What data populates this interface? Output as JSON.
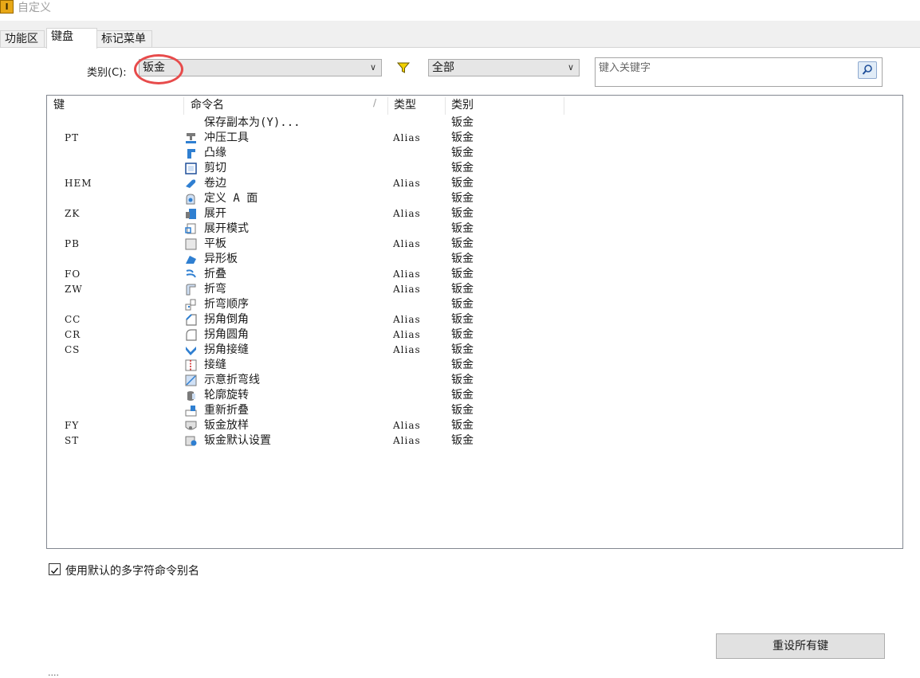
{
  "window": {
    "title": "自定义",
    "app_icon_glyph": "I"
  },
  "tabs": [
    {
      "label": "功能区"
    },
    {
      "label": "键盘"
    },
    {
      "label": "标记菜单"
    }
  ],
  "filters": {
    "category_label": "类别(C):",
    "category_value": "钣金",
    "scope_value": "全部",
    "filter_icon": "funnel-icon",
    "accent_filter": "#f0d000"
  },
  "search": {
    "placeholder": "键入关键字",
    "icon": "search-icon"
  },
  "table": {
    "headers": [
      "键",
      "命令名",
      "类型",
      "类别"
    ],
    "sort_glyph": "/",
    "rows": [
      {
        "key": "",
        "icon": "",
        "name": "保存副本为(Y)...",
        "type": "",
        "category": "钣金"
      },
      {
        "key": "PT",
        "icon": "punch-tool-icon",
        "name": "冲压工具",
        "type": "Alias",
        "category": "钣金"
      },
      {
        "key": "",
        "icon": "flange-icon",
        "name": "凸缘",
        "type": "",
        "category": "钣金"
      },
      {
        "key": "",
        "icon": "cut-icon",
        "name": "剪切",
        "type": "",
        "category": "钣金"
      },
      {
        "key": "HEM",
        "icon": "hem-icon",
        "name": "卷边",
        "type": "Alias",
        "category": "钣金"
      },
      {
        "key": "",
        "icon": "define-a-side-icon",
        "name": "定义 A 面",
        "type": "",
        "category": "钣金"
      },
      {
        "key": "ZK",
        "icon": "unfold-icon",
        "name": "展开",
        "type": "Alias",
        "category": "钣金"
      },
      {
        "key": "",
        "icon": "flat-pattern-icon",
        "name": "展开模式",
        "type": "",
        "category": "钣金"
      },
      {
        "key": "PB",
        "icon": "face-icon",
        "name": "平板",
        "type": "Alias",
        "category": "钣金"
      },
      {
        "key": "",
        "icon": "contour-flange-icon",
        "name": "异形板",
        "type": "",
        "category": "钣金"
      },
      {
        "key": "FO",
        "icon": "fold-icon",
        "name": "折叠",
        "type": "Alias",
        "category": "钣金"
      },
      {
        "key": "ZW",
        "icon": "bend-icon",
        "name": "折弯",
        "type": "Alias",
        "category": "钣金"
      },
      {
        "key": "",
        "icon": "bend-order-icon",
        "name": "折弯顺序",
        "type": "",
        "category": "钣金"
      },
      {
        "key": "CC",
        "icon": "corner-chamfer-icon",
        "name": "拐角倒角",
        "type": "Alias",
        "category": "钣金"
      },
      {
        "key": "CR",
        "icon": "corner-round-icon",
        "name": "拐角圆角",
        "type": "Alias",
        "category": "钣金"
      },
      {
        "key": "CS",
        "icon": "corner-seam-icon",
        "name": "拐角接缝",
        "type": "Alias",
        "category": "钣金"
      },
      {
        "key": "",
        "icon": "rip-icon",
        "name": "接缝",
        "type": "",
        "category": "钣金"
      },
      {
        "key": "",
        "icon": "sketched-bend-icon",
        "name": "示意折弯线",
        "type": "",
        "category": "钣金"
      },
      {
        "key": "",
        "icon": "contour-roll-icon",
        "name": "轮廓旋转",
        "type": "",
        "category": "钣金"
      },
      {
        "key": "",
        "icon": "refold-icon",
        "name": "重新折叠",
        "type": "",
        "category": "钣金"
      },
      {
        "key": "FY",
        "icon": "lofted-flange-icon",
        "name": "钣金放样",
        "type": "Alias",
        "category": "钣金"
      },
      {
        "key": "ST",
        "icon": "sheet-metal-defaults-icon",
        "name": "钣金默认设置",
        "type": "Alias",
        "category": "钣金"
      }
    ]
  },
  "checkbox": {
    "label": "使用默认的多字符命令别名",
    "checked": true
  },
  "reset_button": {
    "label": "重设所有键"
  },
  "footer_dots": "....",
  "colors": {
    "icon_blue": "#2f7fd1",
    "icon_gray": "#7a7a7a",
    "highlight_ring": "#e74b4b"
  }
}
